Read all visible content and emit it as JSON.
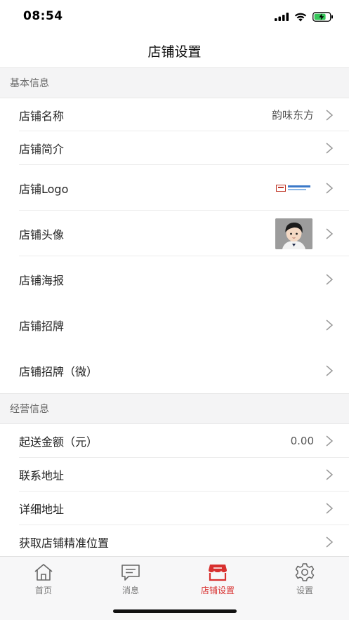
{
  "status_bar": {
    "time": "08:54"
  },
  "nav": {
    "title": "店铺设置"
  },
  "sections": {
    "basic": {
      "header": "基本信息",
      "shop_name": {
        "label": "店铺名称",
        "value": "韵味东方"
      },
      "shop_intro": {
        "label": "店铺简介"
      },
      "shop_logo": {
        "label": "店铺Logo"
      },
      "shop_avatar": {
        "label": "店铺头像"
      },
      "shop_poster": {
        "label": "店铺海报"
      },
      "shop_sign": {
        "label": "店铺招牌"
      },
      "shop_sign_micro": {
        "label": "店铺招牌（微）"
      }
    },
    "business": {
      "header": "经营信息",
      "min_amount": {
        "label": "起送金额（元）",
        "value": "0.00"
      },
      "contact_address": {
        "label": "联系地址"
      },
      "detail_address": {
        "label": "详细地址"
      },
      "precise_location": {
        "label": "获取店铺精准位置"
      }
    }
  },
  "tabs": [
    {
      "label": "首页",
      "icon": "home-icon",
      "active": false
    },
    {
      "label": "消息",
      "icon": "message-icon",
      "active": false
    },
    {
      "label": "店铺设置",
      "icon": "store-icon",
      "active": true
    },
    {
      "label": "设置",
      "icon": "gear-icon",
      "active": false
    }
  ],
  "colors": {
    "accent": "#d8302f",
    "section_bg": "#f4f4f5"
  }
}
